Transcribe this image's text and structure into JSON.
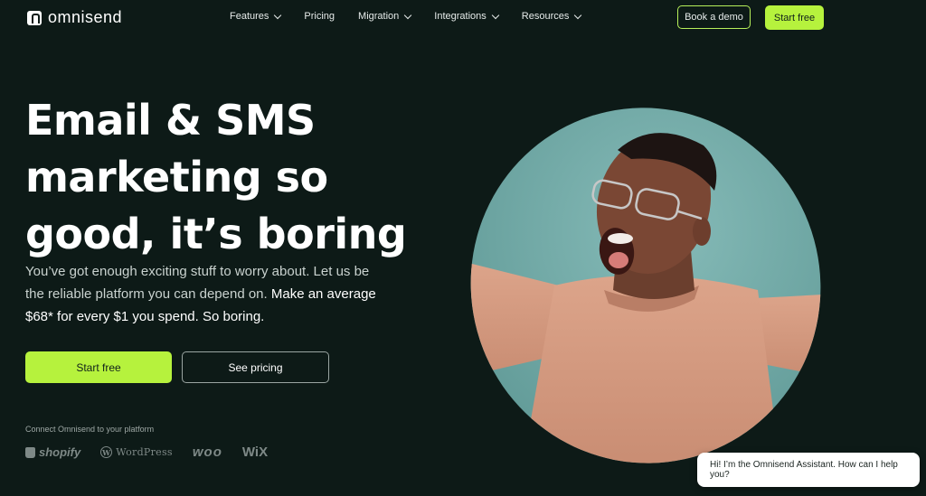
{
  "brand": {
    "name": "omnisend"
  },
  "nav": {
    "items": [
      {
        "label": "Features",
        "has_dropdown": true
      },
      {
        "label": "Pricing",
        "has_dropdown": false
      },
      {
        "label": "Migration",
        "has_dropdown": true
      },
      {
        "label": "Integrations",
        "has_dropdown": true
      },
      {
        "label": "Resources",
        "has_dropdown": true
      }
    ],
    "book_demo_label": "Book a demo",
    "start_free_label": "Start free"
  },
  "hero": {
    "title_lines": [
      "Email & SMS",
      "marketing so",
      "good, it’s boring"
    ],
    "subtitle_part1": "You’ve got enough exciting stuff to worry about. Let us be the reliable platform you can depend on.",
    "subtitle_part2": "Make an average $68* for every $1 you spend. So boring.",
    "primary_cta": "Start free",
    "secondary_cta": "See pricing"
  },
  "platforms": {
    "label": "Connect Omnisend to your platform",
    "items": [
      {
        "name": "shopify",
        "icon": "shopify-bag-icon"
      },
      {
        "name": "WordPress",
        "icon": "wordpress-icon"
      },
      {
        "name": "woo",
        "icon": ""
      },
      {
        "name": "WiX",
        "icon": ""
      }
    ]
  },
  "chat": {
    "message": "Hi! I’m the Omnisend Assistant. How can I help you?"
  },
  "colors": {
    "background": "#0d1a17",
    "accent": "#b6f23d",
    "circle_bg": "#6fa7a4",
    "sweater": "#d39a80"
  }
}
